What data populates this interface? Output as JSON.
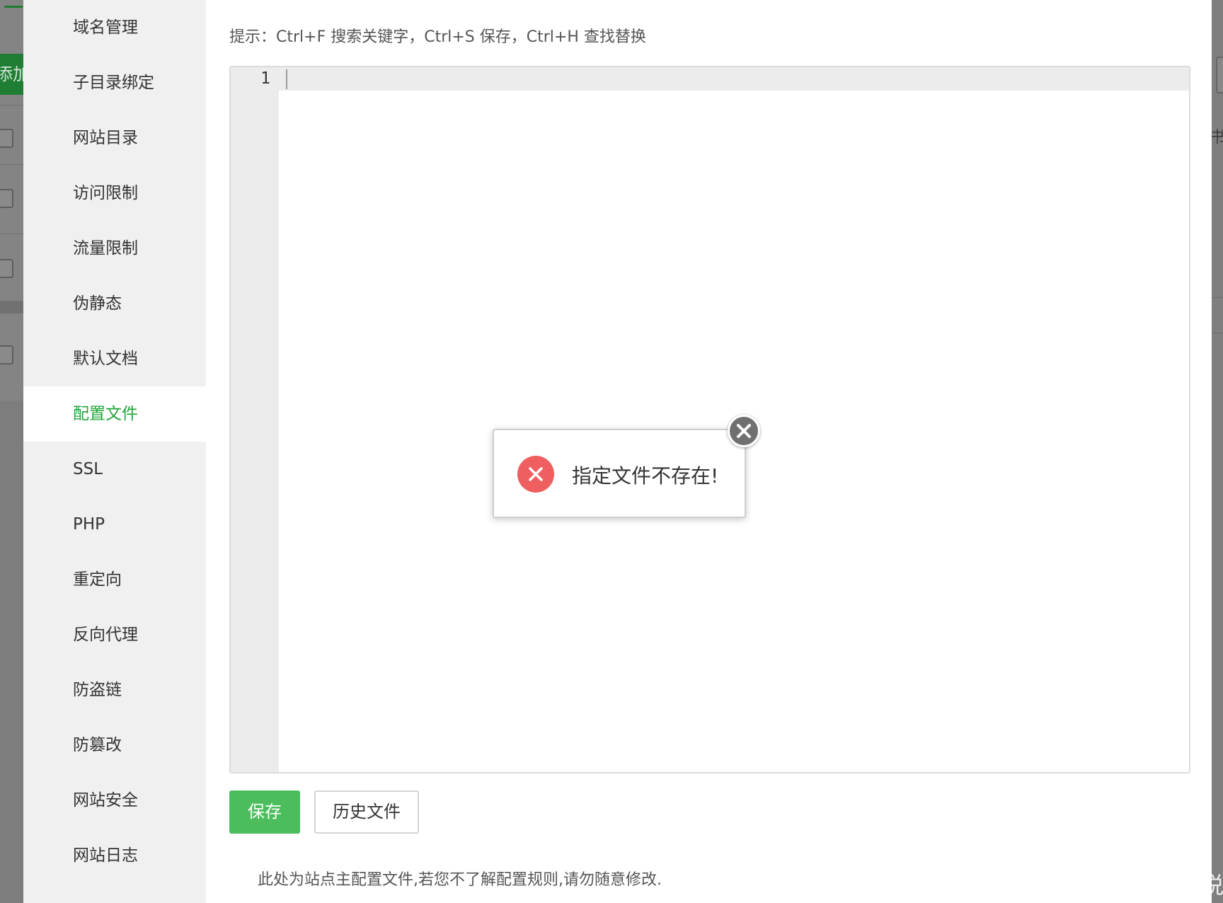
{
  "background": {
    "add_button_label": "添加",
    "right_glyph": "书"
  },
  "sidebar": {
    "items": [
      {
        "label": "域名管理",
        "active": false
      },
      {
        "label": "子目录绑定",
        "active": false
      },
      {
        "label": "网站目录",
        "active": false
      },
      {
        "label": "访问限制",
        "active": false
      },
      {
        "label": "流量限制",
        "active": false
      },
      {
        "label": "伪静态",
        "active": false
      },
      {
        "label": "默认文档",
        "active": false
      },
      {
        "label": "配置文件",
        "active": true
      },
      {
        "label": "SSL",
        "active": false
      },
      {
        "label": "PHP",
        "active": false
      },
      {
        "label": "重定向",
        "active": false
      },
      {
        "label": "反向代理",
        "active": false
      },
      {
        "label": "防盗链",
        "active": false
      },
      {
        "label": "防篡改",
        "active": false
      },
      {
        "label": "网站安全",
        "active": false
      },
      {
        "label": "网站日志",
        "active": false
      }
    ]
  },
  "content": {
    "tip": "提示：Ctrl+F 搜索关键字，Ctrl+S 保存，Ctrl+H 查找替换",
    "editor": {
      "line_number": "1",
      "text": ""
    },
    "save_label": "保存",
    "history_label": "历史文件",
    "note": "此处为站点主配置文件,若您不了解配置规则,请勿随意修改."
  },
  "toast": {
    "message": "指定文件不存在!",
    "icon": "error-x-icon",
    "close_icon": "close-icon"
  },
  "watermark": "CSDN @少湖说",
  "colors": {
    "accent_green": "#20a53a",
    "save_button": "#4cbd5d",
    "error_red": "#ef5f5f",
    "sidebar_bg": "#f0f0f0"
  }
}
